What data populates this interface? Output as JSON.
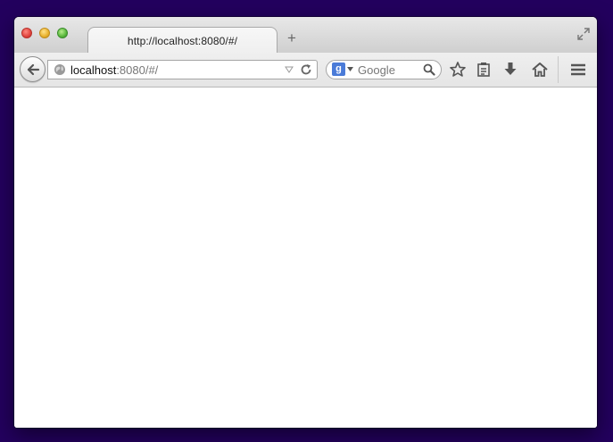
{
  "tab": {
    "title": "http://localhost:8080/#/"
  },
  "url": {
    "host": "localhost",
    "rest": ":8080/#/"
  },
  "search": {
    "placeholder": "Google",
    "engine_letter": "g"
  },
  "icons": {
    "back": "arrow-left-icon",
    "site": "globe-icon",
    "reload": "reload-icon",
    "bookmark": "star-icon",
    "bookmarks_menu": "clipboard-icon",
    "downloads": "download-icon",
    "home": "home-icon",
    "menu": "hamburger-icon",
    "fullscreen": "fullscreen-icon",
    "new_tab": "plus-icon"
  },
  "new_tab_label": "+"
}
